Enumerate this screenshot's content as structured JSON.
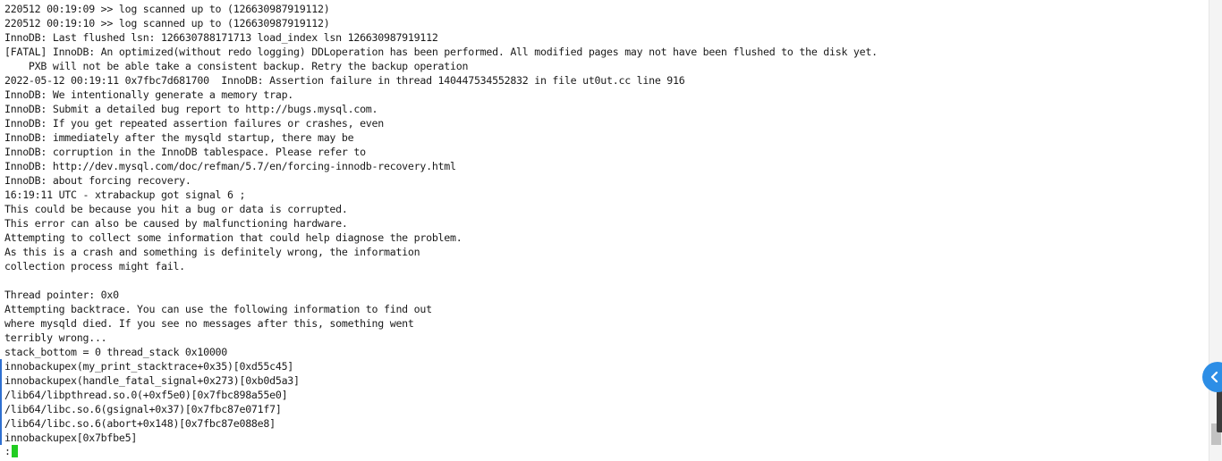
{
  "terminal": {
    "lines": [
      "220512 00:19:09 >> log scanned up to (126630987919112)",
      "220512 00:19:10 >> log scanned up to (126630987919112)",
      "InnoDB: Last flushed lsn: 126630788171713 load_index lsn 126630987919112",
      "[FATAL] InnoDB: An optimized(without redo logging) DDLoperation has been performed. All modified pages may not have been flushed to the disk yet.",
      "    PXB will not be able take a consistent backup. Retry the backup operation",
      "2022-05-12 00:19:11 0x7fbc7d681700  InnoDB: Assertion failure in thread 140447534552832 in file ut0ut.cc line 916",
      "InnoDB: We intentionally generate a memory trap.",
      "InnoDB: Submit a detailed bug report to http://bugs.mysql.com.",
      "InnoDB: If you get repeated assertion failures or crashes, even",
      "InnoDB: immediately after the mysqld startup, there may be",
      "InnoDB: corruption in the InnoDB tablespace. Please refer to",
      "InnoDB: http://dev.mysql.com/doc/refman/5.7/en/forcing-innodb-recovery.html",
      "InnoDB: about forcing recovery.",
      "16:19:11 UTC - xtrabackup got signal 6 ;",
      "This could be because you hit a bug or data is corrupted.",
      "This error can also be caused by malfunctioning hardware.",
      "Attempting to collect some information that could help diagnose the problem.",
      "As this is a crash and something is definitely wrong, the information",
      "collection process might fail.",
      "",
      "Thread pointer: 0x0",
      "Attempting backtrace. You can use the following information to find out",
      "where mysqld died. If you see no messages after this, something went",
      "terribly wrong...",
      "stack_bottom = 0 thread_stack 0x10000",
      "innobackupex(my_print_stacktrace+0x35)[0xd55c45]",
      "innobackupex(handle_fatal_signal+0x273)[0xb0d5a3]",
      "/lib64/libpthread.so.0(+0xf5e0)[0x7fbc898a55e0]",
      "/lib64/libc.so.6(gsignal+0x37)[0x7fbc87e071f7]",
      "/lib64/libc.so.6(abort+0x148)[0x7fbc87e088e8]",
      "innobackupex[0x7bfbe5]"
    ],
    "prompt": ":",
    "cursor_color": "#22cc22",
    "text_color": "#1a1a1a",
    "background_color": "#ffffff"
  },
  "side_toggle": {
    "icon": "chevron-left-icon",
    "color": "#2d8ee6"
  }
}
